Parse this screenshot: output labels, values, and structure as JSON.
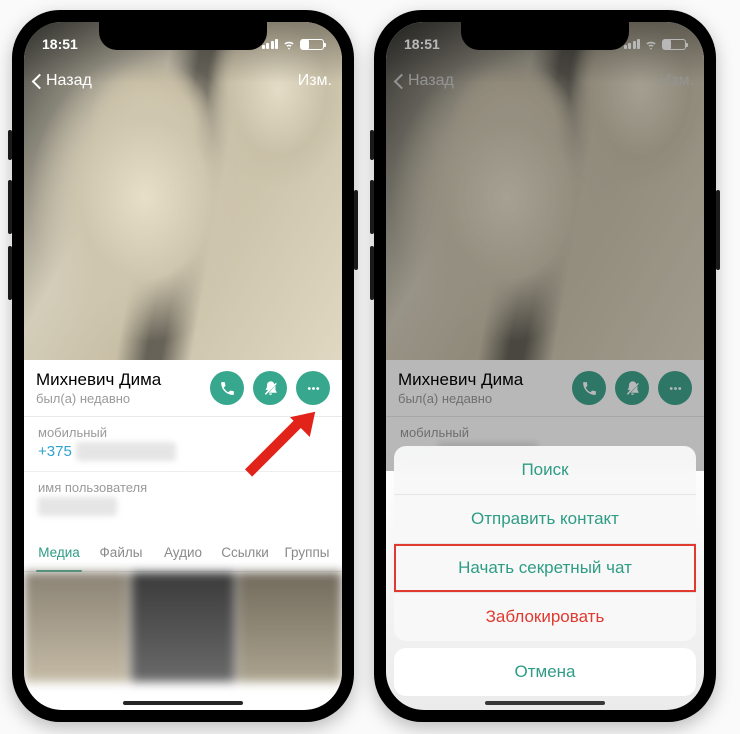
{
  "statusbar": {
    "time": "18:51"
  },
  "nav": {
    "back": "Назад",
    "edit": "Изм."
  },
  "contact": {
    "name": "Михневич Дима",
    "status": "был(а) недавно",
    "phone_label": "мобильный",
    "phone_value": "+375",
    "username_label": "имя пользователя"
  },
  "tabs": {
    "media": "Медиа",
    "files": "Файлы",
    "audio": "Аудио",
    "links": "Ссылки",
    "groups": "Группы"
  },
  "sheet": {
    "search": "Поиск",
    "send_contact": "Отправить контакт",
    "secret_chat": "Начать секретный чат",
    "block": "Заблокировать",
    "cancel": "Отмена"
  },
  "icons": {
    "call": "call-icon",
    "mute": "bell-slash-icon",
    "more": "more-icon"
  }
}
